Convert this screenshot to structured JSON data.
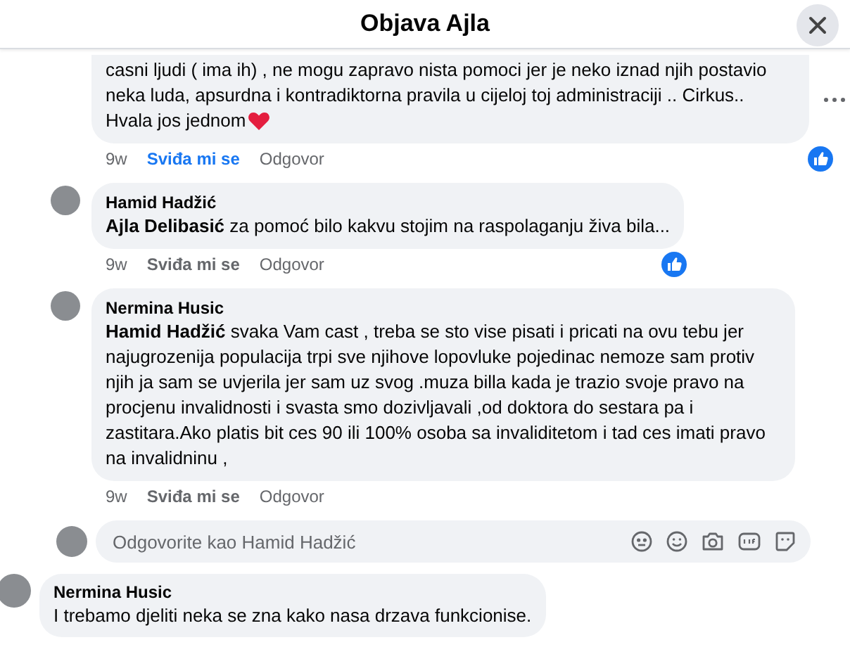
{
  "header": {
    "title": "Objava Ajla"
  },
  "thread": {
    "comment": {
      "text": "casni ljudi ( ima ih) , ne mogu zapravo nista pomoci jer je neko iznad njih postavio neka luda, apsurdna i kontradiktorna pravila u cijeloj toj administraciji .. Cirkus..",
      "closing": "Hvala jos jednom",
      "time": "9w",
      "like_label": "Sviđa mi se",
      "reply_label": "Odgovor",
      "liked": true,
      "reacted": true
    },
    "replies": [
      {
        "author": "Hamid Hadžić",
        "text": "**Ajla Delibasić** za pomoć bilo kakvu stojim na raspolaganju živa bila...",
        "time": "9w",
        "like_label": "Sviđa mi se",
        "reply_label": "Odgovor",
        "liked": false,
        "reacted": true
      },
      {
        "author": "Nermina Husic",
        "text": "**Hamid Hadžić** svaka Vam cast , treba se sto vise pisati i pricati na ovu tebu jer najugrozenija populacija trpi sve njihove lopovluke pojedinac nemoze sam protiv njih ja sam se uvjerila jer sam uz svog .muza billa kada je trazio svoje pravo na procjenu invalidnosti i svasta smo dozivljavali ,od doktora do sestara pa i zastitara.Ako platis bit ces 90 ili 100% osoba sa invaliditetom i tad ces imati pravo na invalidninu ,",
        "time": "9w",
        "like_label": "Sviđa mi se",
        "reply_label": "Odgovor",
        "liked": false,
        "reacted": false
      }
    ],
    "reply_box": {
      "placeholder": "Odgovorite kao Hamid Hadžić"
    }
  },
  "next_comment": {
    "author": "Nermina Husic",
    "text": "I trebamo djeliti neka se zna kako nasa drzava funkcionise."
  }
}
